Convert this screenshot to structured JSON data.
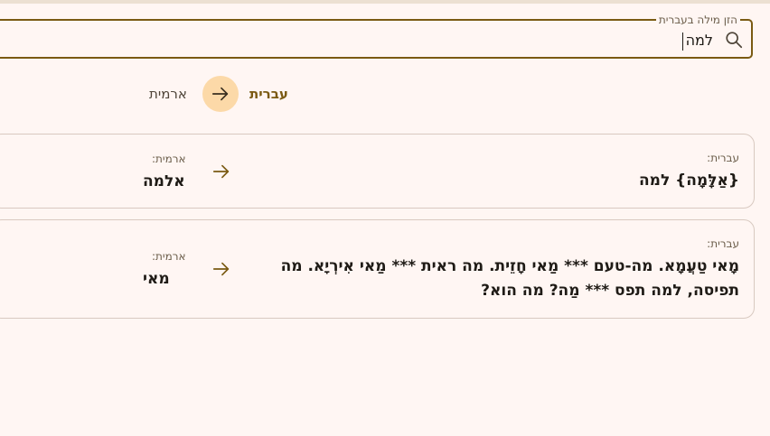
{
  "search": {
    "legend": "הזן מילה בעברית",
    "value": "למה",
    "icon": "search-icon"
  },
  "languages": {
    "source": "עברית",
    "target": "ארמית",
    "swap_icon": "arrow-right-icon"
  },
  "results": [
    {
      "source_label": "עברית:",
      "source_text": "{אַלָּמָה} למה",
      "target_label": "ארמית:",
      "target_text": "אלמה"
    },
    {
      "source_label": "עברית:",
      "source_text": "מָאי טַעֲמָא. מה-טעם *** מַאי חָזֵית. מה ראית *** מַאי אִירְיָא. מה תפיסה, למה תפס *** מַה? מה הוא?",
      "target_label": "ארמית:",
      "target_text": "מאי"
    }
  ],
  "colors": {
    "accent": "#7a5a12",
    "swap_bg": "#fcd9a8",
    "background": "#fff6f3",
    "card_border": "#d8c9c0"
  }
}
